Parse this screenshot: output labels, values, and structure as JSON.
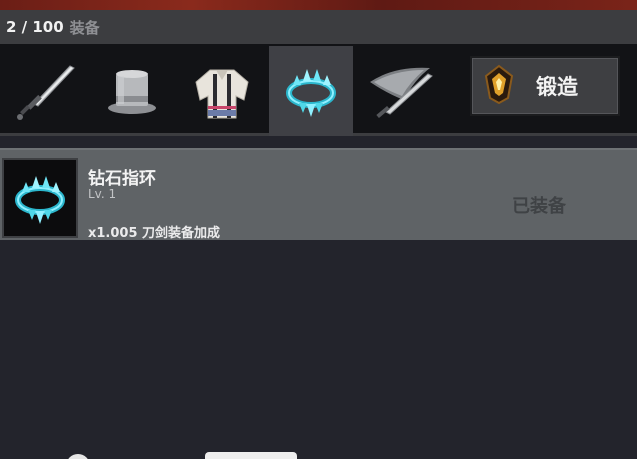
{
  "header": {
    "count": "2 / 100",
    "label": "装备"
  },
  "tabs": [
    {
      "icon": "sword-icon",
      "active": false
    },
    {
      "icon": "top-hat-icon",
      "active": false
    },
    {
      "icon": "jacket-icon",
      "active": false
    },
    {
      "icon": "diamond-ring-icon",
      "active": true
    },
    {
      "icon": "feather-blade-icon",
      "active": false
    }
  ],
  "forge": {
    "label": "锻造",
    "icon": "forge-gem-icon"
  },
  "item": {
    "name": "钻石指环",
    "level": "Lv. 1",
    "bonus": "x1.005 刀剑装备加成",
    "status": "已装备",
    "icon": "diamond-ring-icon"
  },
  "colors": {
    "background": "#23242c",
    "header": "#3c3d40",
    "tabbar": "#121316",
    "active_tab": "#3f4045",
    "item_row": "#5f6366",
    "gem_accent": "#4fd7e8"
  }
}
